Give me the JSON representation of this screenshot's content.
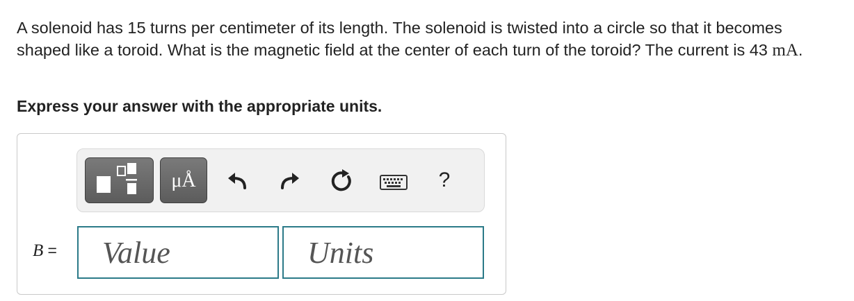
{
  "question": {
    "text_before_unit": "A solenoid has 15 turns per centimeter of its length. The solenoid is twisted into a circle so that it becomes shaped like a toroid. What is the magnetic field at the center of each turn of the toroid? The current is 43 ",
    "unit": "mA",
    "text_after_unit": "."
  },
  "instruction": "Express your answer with the appropriate units.",
  "toolbar": {
    "templates_icon": "templates-icon",
    "units_button_label": "μÅ",
    "undo_icon": "undo-icon",
    "redo_icon": "redo-icon",
    "reset_icon": "reset-icon",
    "keyboard_icon": "keyboard-icon",
    "help_label": "?"
  },
  "answer": {
    "variable": "B",
    "equals": "=",
    "value_placeholder": "Value",
    "units_placeholder": "Units",
    "value": "",
    "units": ""
  },
  "colors": {
    "field_border": "#2b7a88",
    "toolbar_bg": "#f1f1f1",
    "button_bg": "#6b6b6b"
  }
}
